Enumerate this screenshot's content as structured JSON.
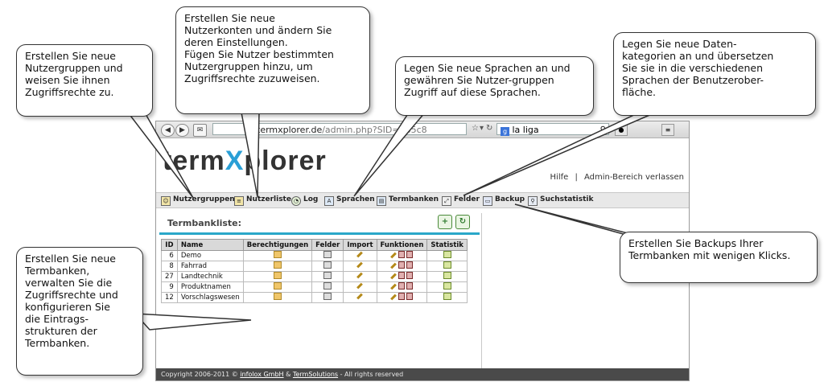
{
  "browser": {
    "url_host": "termxplorer.de",
    "url_path": "/admin.php?SID=785c8",
    "search_text": "la liga"
  },
  "app": {
    "logo_part1": "term",
    "logo_part2": "X",
    "logo_part3": "plorer",
    "help_link": "Hilfe",
    "separator": "|",
    "admin_exit_link": "Admin-Bereich verlassen"
  },
  "menu": [
    {
      "label": "Nutzergruppen",
      "icon": "users-icon"
    },
    {
      "label": "Nutzerliste",
      "icon": "user-list-icon"
    },
    {
      "label": "Log",
      "icon": "clock-icon"
    },
    {
      "label": "Sprachen",
      "icon": "language-icon"
    },
    {
      "label": "Termbanken",
      "icon": "database-icon"
    },
    {
      "label": "Felder",
      "icon": "fields-icon"
    },
    {
      "label": "Backup",
      "icon": "backup-icon"
    },
    {
      "label": "Suchstatistik",
      "icon": "search-stats-icon"
    }
  ],
  "panel": {
    "title": "Termbankliste:",
    "columns": [
      "ID",
      "Name",
      "Berechtigungen",
      "Felder",
      "Import",
      "Funktionen",
      "Statistik"
    ],
    "rows": [
      {
        "id": "6",
        "name": "Demo"
      },
      {
        "id": "8",
        "name": "Fahrrad"
      },
      {
        "id": "27",
        "name": "Landtechnik"
      },
      {
        "id": "9",
        "name": "Produktnamen"
      },
      {
        "id": "12",
        "name": "Vorschlagswesen"
      }
    ]
  },
  "footer": {
    "prefix": "Copyright 2006-2011 ©",
    "company1": "infolox GmbH",
    "amp": "&",
    "company2": "TermSolutions",
    "suffix": "- All rights reserved"
  },
  "callouts": {
    "nutzergruppen": "Erstellen Sie neue\nNutzergruppen und\nweisen Sie ihnen\nZugriffsrechte zu.",
    "nutzerliste": "Erstellen Sie neue\nNutzerkonten und ändern Sie\nderen Einstellungen.\nFügen Sie Nutzer bestimmten\nNutzergruppen hinzu, um\nZugriffsrechte zuzuweisen.",
    "sprachen": "Legen Sie neue Sprachen an und\ngewähren Sie Nutzer-gruppen\nZugriff auf diese Sprachen.",
    "felder": "Legen Sie neue Daten-\nkategorien an und übersetzen\nSie sie in die verschiedenen\nSprachen der Benutzerober-\nfläche.",
    "backup": "Erstellen Sie Backups Ihrer\nTermbanken mit wenigen Klicks.",
    "termbanken": "Erstellen Sie neue\nTermbanken,\nverwalten Sie die\nZugriffsrechte und\nkonfigurieren Sie\ndie Eintrags-\nstrukturen der\nTermbanken."
  }
}
